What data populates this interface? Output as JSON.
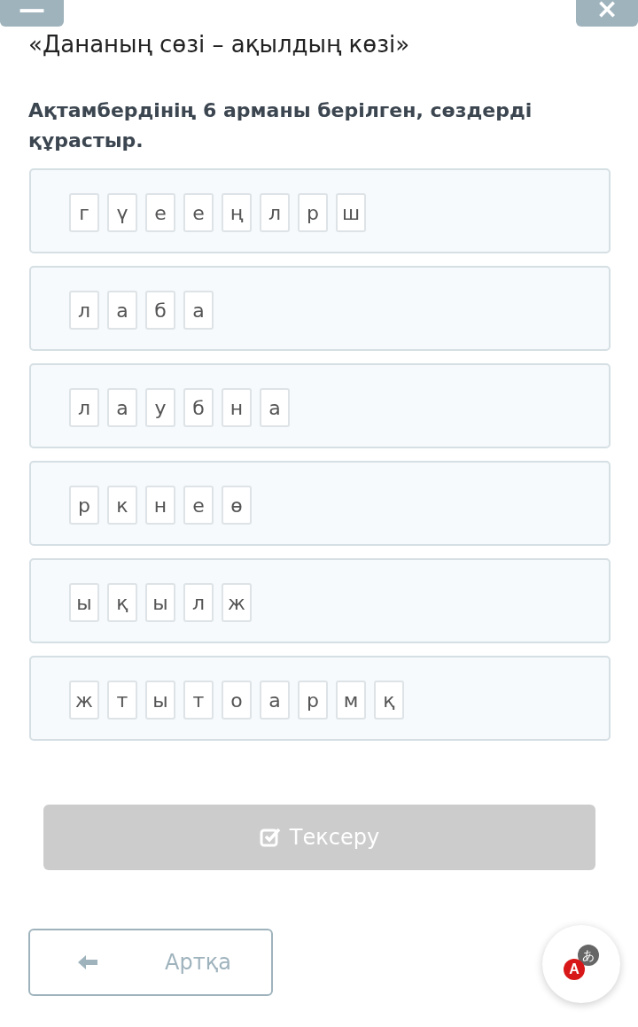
{
  "top_bar": {
    "menu_button": "—",
    "close_button": "×"
  },
  "title": "«Дананың сөзі – ақылдың көзі»",
  "instruction": "Ақтамбердінің 6 арманы берілген, сөздерді құрастыр.",
  "words": [
    {
      "letters": [
        "г",
        "ү",
        "е",
        "е",
        "ң",
        "л",
        "р",
        "ш"
      ]
    },
    {
      "letters": [
        "л",
        "а",
        "б",
        "а"
      ]
    },
    {
      "letters": [
        "л",
        "а",
        "у",
        "б",
        "н",
        "а"
      ]
    },
    {
      "letters": [
        "р",
        "к",
        "н",
        "е",
        "ө"
      ]
    },
    {
      "letters": [
        "ы",
        "қ",
        "ы",
        "л",
        "ж"
      ]
    },
    {
      "letters": [
        "ж",
        "т",
        "ы",
        "т",
        "о",
        "а",
        "р",
        "м",
        "қ"
      ]
    }
  ],
  "check_button": {
    "label": "Тексеру",
    "disabled": true
  },
  "back_button": {
    "label": "Артқа"
  },
  "translate_button": {
    "badge": "A",
    "glyph": "あ"
  }
}
